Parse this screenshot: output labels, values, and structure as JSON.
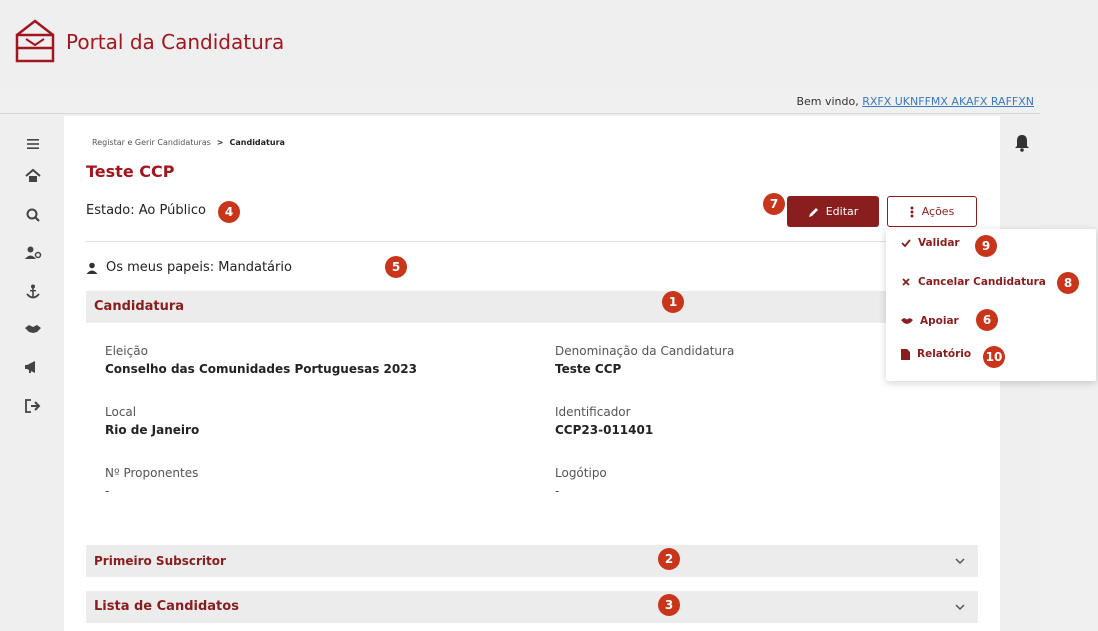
{
  "header": {
    "title": "Portal da Candidatura"
  },
  "welcome": {
    "prefix": "Bem vindo,",
    "user": "RXFX UKNFFMX AKAFX RAFFXN"
  },
  "sidebar": {
    "items": [
      {
        "icon": "menu-icon"
      },
      {
        "icon": "home-icon"
      },
      {
        "icon": "search-icon"
      },
      {
        "icon": "user-settings-icon"
      },
      {
        "icon": "anchor-icon"
      },
      {
        "icon": "handshake-icon"
      },
      {
        "icon": "megaphone-icon"
      },
      {
        "icon": "logout-icon"
      }
    ]
  },
  "breadcrumb": {
    "parent": "Registar e Gerir Candidaturas",
    "separator": ">",
    "current": "Candidatura"
  },
  "page": {
    "title": "Teste CCP",
    "estado": "Estado: Ao Público",
    "papeis": "Os meus papeis: Mandatário"
  },
  "toolbar": {
    "editar_label": "Editar",
    "acoes_label": "Ações"
  },
  "actions_menu": [
    {
      "label": "Validar",
      "icon": "check-icon",
      "badge": "9"
    },
    {
      "label": "Cancelar Candidatura",
      "icon": "x-icon",
      "badge": "8"
    },
    {
      "label": "Apoiar",
      "icon": "handshake-icon",
      "badge": "6"
    },
    {
      "label": "Relatório",
      "icon": "document-icon",
      "badge": "10"
    }
  ],
  "sections": {
    "candidatura": {
      "title": "Candidatura",
      "badge": "1"
    },
    "primeiro_subscritor": {
      "title": "Primeiro Subscritor",
      "badge": "2"
    },
    "lista_candidatos": {
      "title": "Lista de Candidatos",
      "badge": "3"
    }
  },
  "badges": {
    "estado": "4",
    "papeis": "5",
    "editar": "7"
  },
  "fields": {
    "eleicao": {
      "label": "Eleição",
      "value": "Conselho das Comunidades Portuguesas 2023"
    },
    "denominacao": {
      "label": "Denominação da Candidatura",
      "value": "Teste CCP"
    },
    "local": {
      "label": "Local",
      "value": "Rio de Janeiro"
    },
    "identificador": {
      "label": "Identificador",
      "value": "CCP23-011401"
    },
    "proponentes": {
      "label": "Nº Proponentes",
      "value": "-"
    },
    "logotipo": {
      "label": "Logótipo",
      "value": "-"
    }
  },
  "colors": {
    "brand": "#a3161f",
    "button": "#8a1d1d",
    "badge": "#c8351a"
  }
}
